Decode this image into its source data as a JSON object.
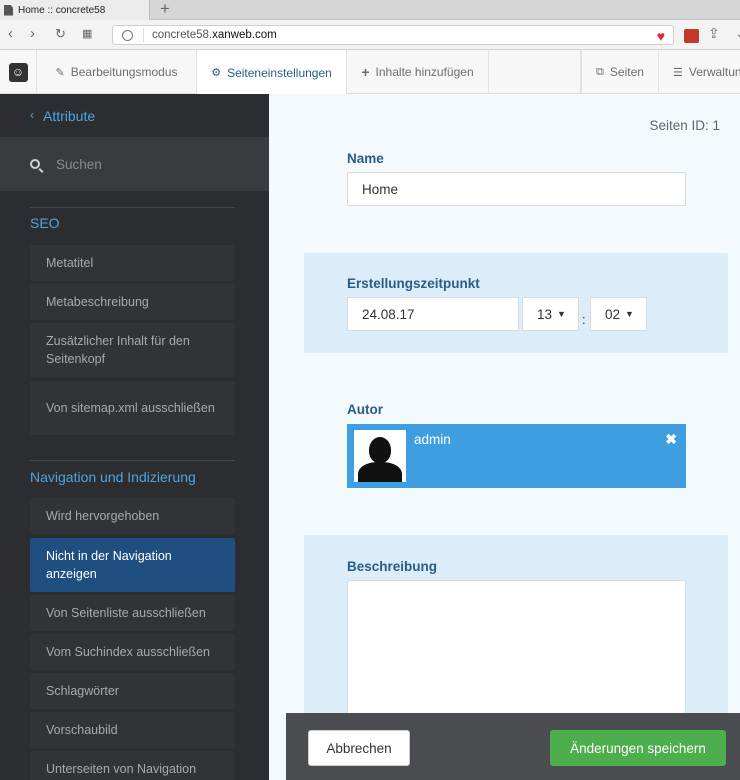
{
  "browser": {
    "tab_title": "Home :: concrete58",
    "new_tab": "+",
    "url_prefix": "concrete58.",
    "url_domain": "xanweb.com"
  },
  "toolbar": {
    "edit_mode": "Bearbeitungsmodus",
    "page_settings": "Seiteneinstellungen",
    "add_content": "Inhalte hinzufügen",
    "pages": "Seiten",
    "manage": "Verwaltung"
  },
  "sidebar": {
    "back_label": "Attribute",
    "search_placeholder": "Suchen",
    "sections": [
      {
        "title": "SEO",
        "items": [
          "Metatitel",
          "Metabeschreibung",
          "Zusätzlicher Inhalt für den Seitenkopf",
          "Von sitemap.xml ausschließen"
        ]
      },
      {
        "title": "Navigation und Indizierung",
        "items": [
          "Wird hervorgehoben",
          "Nicht in der Navigation anzeigen",
          "Von Seitenliste ausschließen",
          "Vom Suchindex ausschließen",
          "Schlagwörter",
          "Vorschaubild",
          "Unterseiten von Navigation"
        ]
      }
    ],
    "selected_item": "Nicht in der Navigation anzeigen"
  },
  "main": {
    "page_id": "Seiten ID: 1",
    "name_label": "Name",
    "name_value": "Home",
    "created_label": "Erstellungszeitpunkt",
    "date_value": "24.08.17",
    "hour_value": "13",
    "minute_value": "02",
    "time_separator": ":",
    "author_label": "Autor",
    "author_name": "admin",
    "description_label": "Beschreibung"
  },
  "footer": {
    "cancel": "Abbrechen",
    "save": "Änderungen speichern"
  },
  "colors": {
    "accent": "#4fa4e1",
    "sidebar_bg": "#2c2d30",
    "selected": "#1e4f80",
    "author_bg": "#3f9ee0",
    "save": "#4cae4c"
  }
}
